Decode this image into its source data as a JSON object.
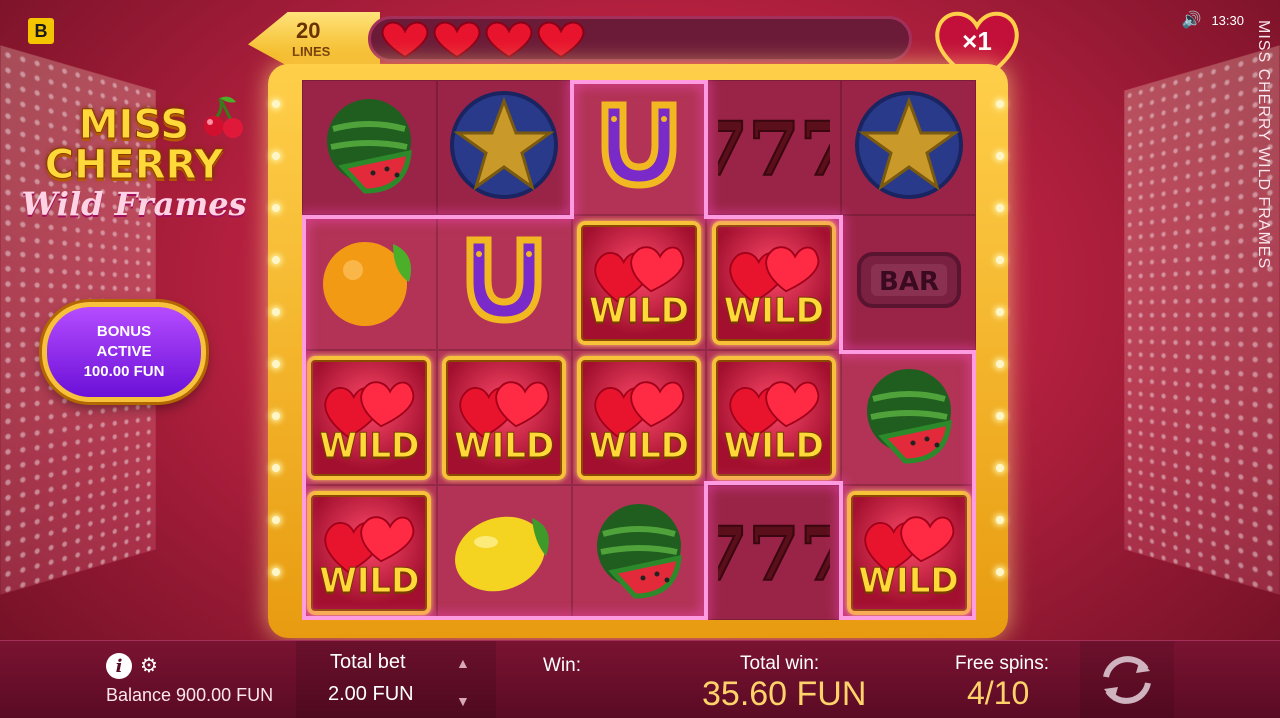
{
  "brand": {
    "letter": "B"
  },
  "status": {
    "time": "13:30",
    "speaker_icon": "speaker-icon"
  },
  "side_title": "MISS CHERRY WILD FRAMES",
  "logo": {
    "line1": "MISS",
    "line2": "CHERRY",
    "line3": "Wild Frames"
  },
  "bonus": {
    "line1": "BONUS",
    "line2": "ACTIVE",
    "line3": "100.00 FUN"
  },
  "lines": {
    "number": "20",
    "label": "LINES"
  },
  "heart_meter": {
    "filled": 4,
    "total": 10
  },
  "multiplier": "×1",
  "reels": [
    [
      "watermelon",
      "star",
      "horseshoe",
      "seven",
      "star"
    ],
    [
      "orange",
      "horseshoe",
      "wild",
      "wild",
      "bar"
    ],
    [
      "wild",
      "wild",
      "wild",
      "wild",
      "watermelon"
    ],
    [
      "wild",
      "lemon",
      "watermelon",
      "seven",
      "wild"
    ]
  ],
  "wild_label": "WILD",
  "bar_label": "BAR",
  "bottom": {
    "balance": "Balance 900.00 FUN",
    "total_bet_label": "Total bet",
    "total_bet_value": "2.00 FUN",
    "win_label": "Win:",
    "total_win_label": "Total win:",
    "total_win_value": "35.60 FUN",
    "free_spins_label": "Free spins:",
    "free_spins_value": "4/10"
  },
  "colors": {
    "accent_gold": "#f7c23a",
    "background_pink": "#b3203f",
    "win_highlight": "#ffd36a"
  }
}
